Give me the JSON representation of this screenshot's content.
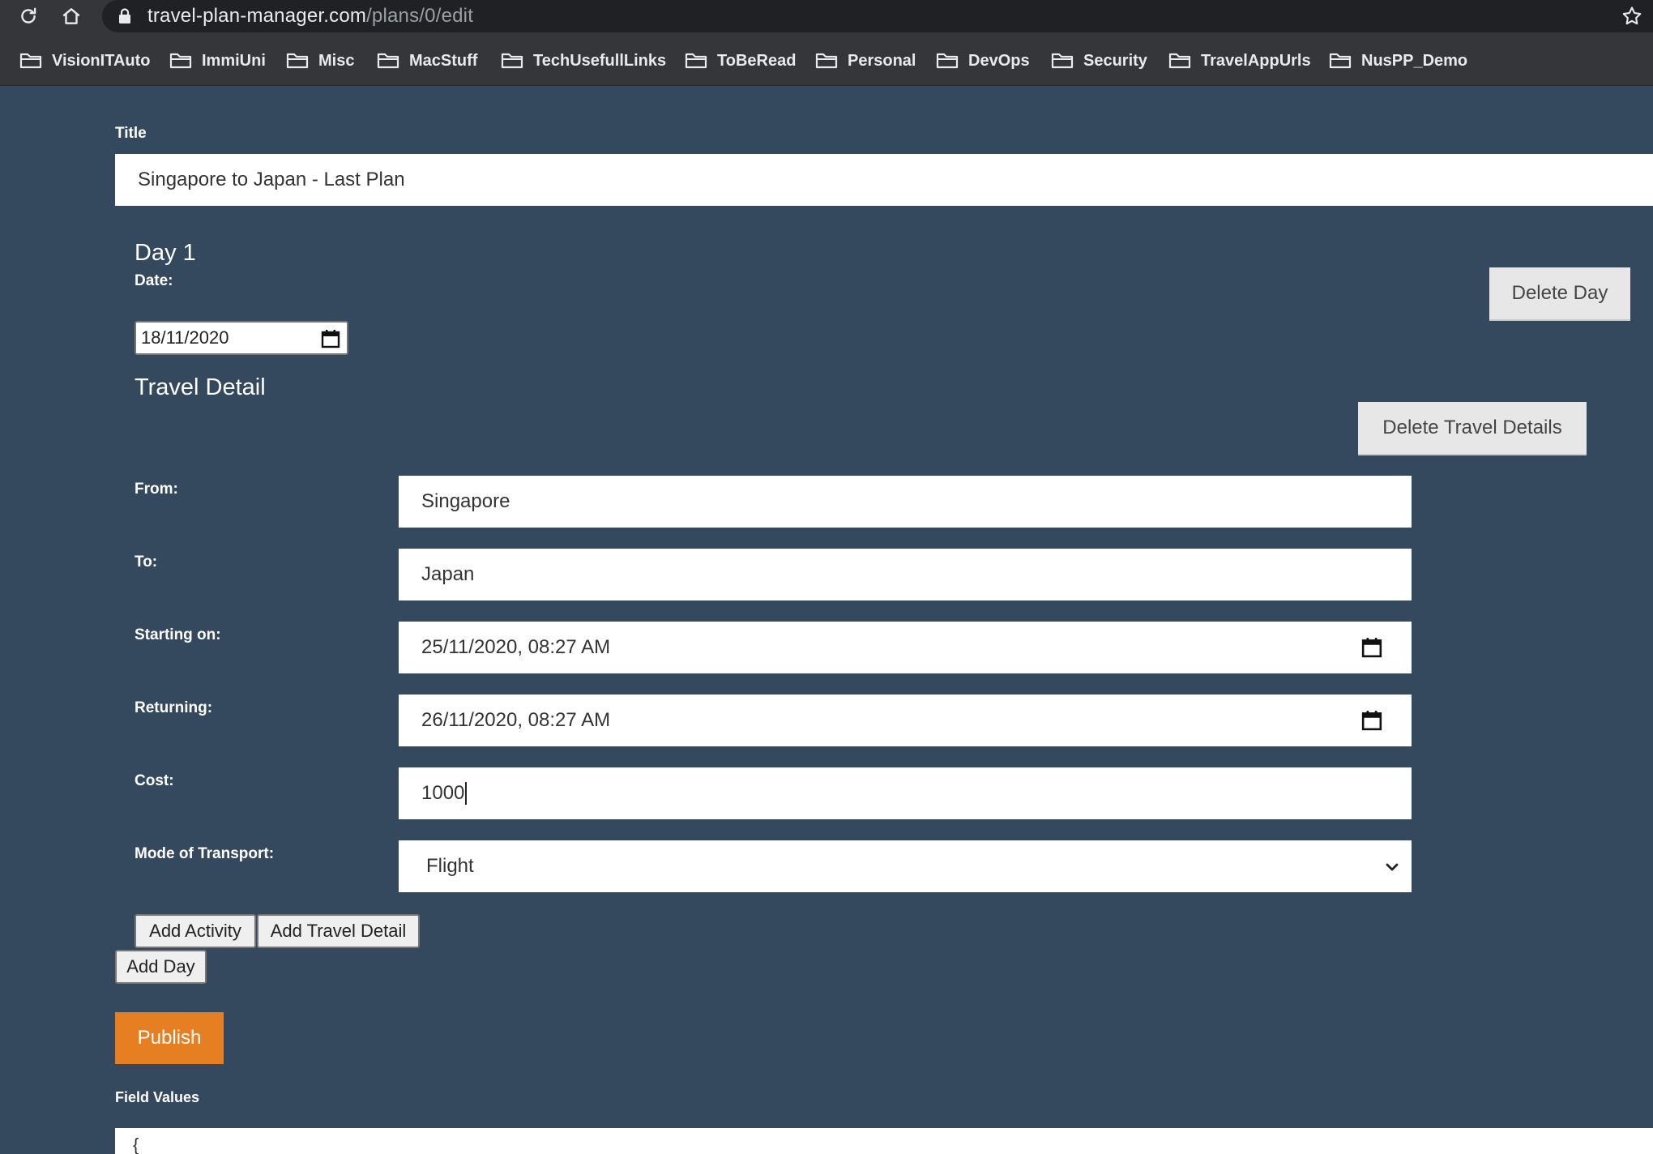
{
  "browser": {
    "url_host": "travel-plan-manager.com",
    "url_path": "/plans/0/edit",
    "bookmarks": [
      {
        "label": "VisionITAuto"
      },
      {
        "label": "ImmiUni"
      },
      {
        "label": "Misc"
      },
      {
        "label": "MacStuff"
      },
      {
        "label": "TechUsefullLinks"
      },
      {
        "label": "ToBeRead"
      },
      {
        "label": "Personal"
      },
      {
        "label": "DevOps"
      },
      {
        "label": "Security"
      },
      {
        "label": "TravelAppUrls"
      },
      {
        "label": "NusPP_Demo"
      }
    ]
  },
  "form": {
    "title_label": "Title",
    "title_value": "Singapore to Japan - Last Plan",
    "day": {
      "heading": "Day 1",
      "date_label": "Date:",
      "date_value": "18/11/2020",
      "delete_day_label": "Delete Day"
    },
    "travel_detail": {
      "heading": "Travel Detail",
      "delete_label": "Delete Travel Details",
      "from_label": "From:",
      "from_value": "Singapore",
      "to_label": "To:",
      "to_value": "Japan",
      "starting_label": "Starting on:",
      "starting_value": "25/11/2020, 08:27 AM",
      "returning_label": "Returning:",
      "returning_value": "26/11/2020, 08:27 AM",
      "cost_label": "Cost:",
      "cost_value": "1000",
      "transport_label": "Mode of Transport:",
      "transport_value": "Flight"
    },
    "add_activity_label": "Add Activity",
    "add_travel_detail_label": "Add Travel Detail",
    "add_day_label": "Add Day",
    "publish_label": "Publish",
    "field_values_label": "Field Values",
    "field_values_text": "{"
  },
  "colors": {
    "page_bg": "#34495e",
    "publish_bg": "#e67e22"
  }
}
